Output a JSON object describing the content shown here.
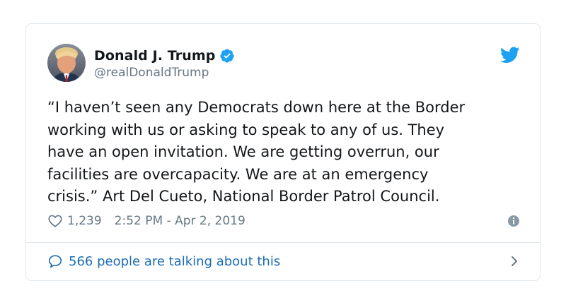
{
  "author": {
    "display_name": "Donald J. Trump",
    "handle": "@realDonaldTrump",
    "verified": true
  },
  "tweet": {
    "text": "“I haven’t seen any Democrats down here at the Border\nworking with us or asking to speak to any of us. They\nhave an open invitation. We are getting overrun, our\nfacilities are overcapacity. We are at an emergency\ncrisis.” Art Del Cueto, National Border Patrol Council.",
    "likes": "1,239",
    "timestamp": "2:52 PM - Apr 2, 2019"
  },
  "footer": {
    "conversation_label": "566 people are talking about this"
  },
  "icons": {
    "brand": "twitter-bird-icon",
    "verified": "verified-badge-icon",
    "like": "heart-icon",
    "info": "info-icon",
    "reply": "speech-bubble-icon",
    "navigate": "chevron-right-icon"
  },
  "colors": {
    "brand_blue": "#1da1f2",
    "link_blue": "#1b6db5",
    "text": "#14171a",
    "muted": "#657786",
    "border": "#e1e8ed"
  }
}
